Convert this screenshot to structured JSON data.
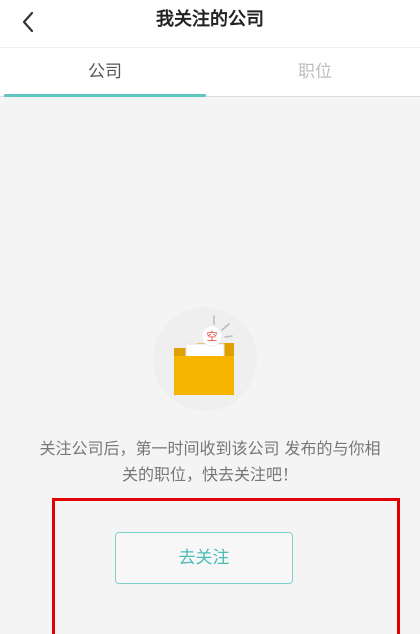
{
  "header": {
    "title": "我关注的公司",
    "back_icon": "chevron-left-icon"
  },
  "tabs": [
    {
      "label": "公司",
      "active": true
    },
    {
      "label": "职位",
      "active": false
    }
  ],
  "empty_state": {
    "icon": "empty-folder-icon",
    "badge_text": "空",
    "message_line1": "关注公司后，第一时间收到该公司 发布的与你相",
    "message_line2": "关的职位，快去关注吧！"
  },
  "action": {
    "label": "去关注"
  },
  "colors": {
    "accent": "#5fc6c2",
    "folder": "#f7b500",
    "highlight": "#e00000"
  }
}
